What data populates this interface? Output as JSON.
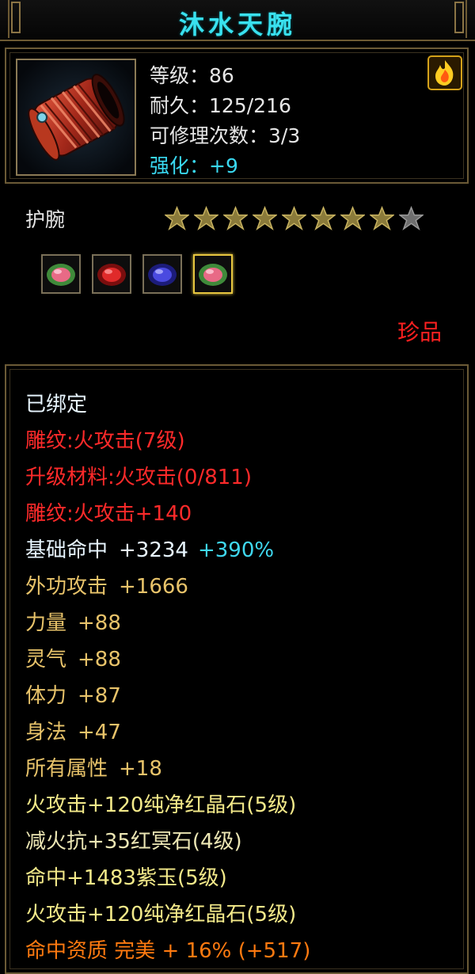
{
  "title": "沐水天腕",
  "item": {
    "level": "等级：86",
    "durability": "耐久：125/216",
    "repairs": "可修理次数：3/3",
    "enhance": "强化：+9"
  },
  "type_label": "护腕",
  "stars": {
    "filled": 8,
    "total": 9
  },
  "gems": [
    {
      "icon": "green-red-gem-icon",
      "active": false
    },
    {
      "icon": "red-crystal-gem-icon",
      "active": false
    },
    {
      "icon": "purple-jade-gem-icon",
      "active": false
    },
    {
      "icon": "green-red-gem-icon",
      "active": true
    }
  ],
  "rarity": "珍品",
  "attributes": {
    "bound": "已绑定",
    "engrave1": "雕纹:火攻击(7级)",
    "upgrade_material": "升级材料:火攻击(0/811)",
    "engrave2": "雕纹:火攻击+140",
    "hit_label": "基础命中",
    "hit_value": "+3234",
    "hit_bonus": "+390%",
    "outer_attack_label": "外功攻击",
    "outer_attack_value": "+1666",
    "strength_label": "力量",
    "strength_value": "+88",
    "spirit_label": "灵气",
    "spirit_value": "+88",
    "stamina_label": "体力",
    "stamina_value": "+87",
    "agility_label": "身法",
    "agility_value": "+47",
    "all_label": "所有属性",
    "all_value": "+18",
    "gem1": "火攻击+120纯净红晶石(5级)",
    "gem2": "减火抗+35红冥石(4级)",
    "gem3": "命中+1483紫玉(5级)",
    "gem4": "火攻击+120纯净红晶石(5级)",
    "aptitude": "命中资质 完美 + 16% (+517)"
  },
  "colors": {
    "title": "#39e1ef",
    "red": "#ff2a2a",
    "gold": "#e8c36a",
    "cyan": "#3fd8ef",
    "orange": "#ff7a10",
    "border": "#6b5a36"
  }
}
